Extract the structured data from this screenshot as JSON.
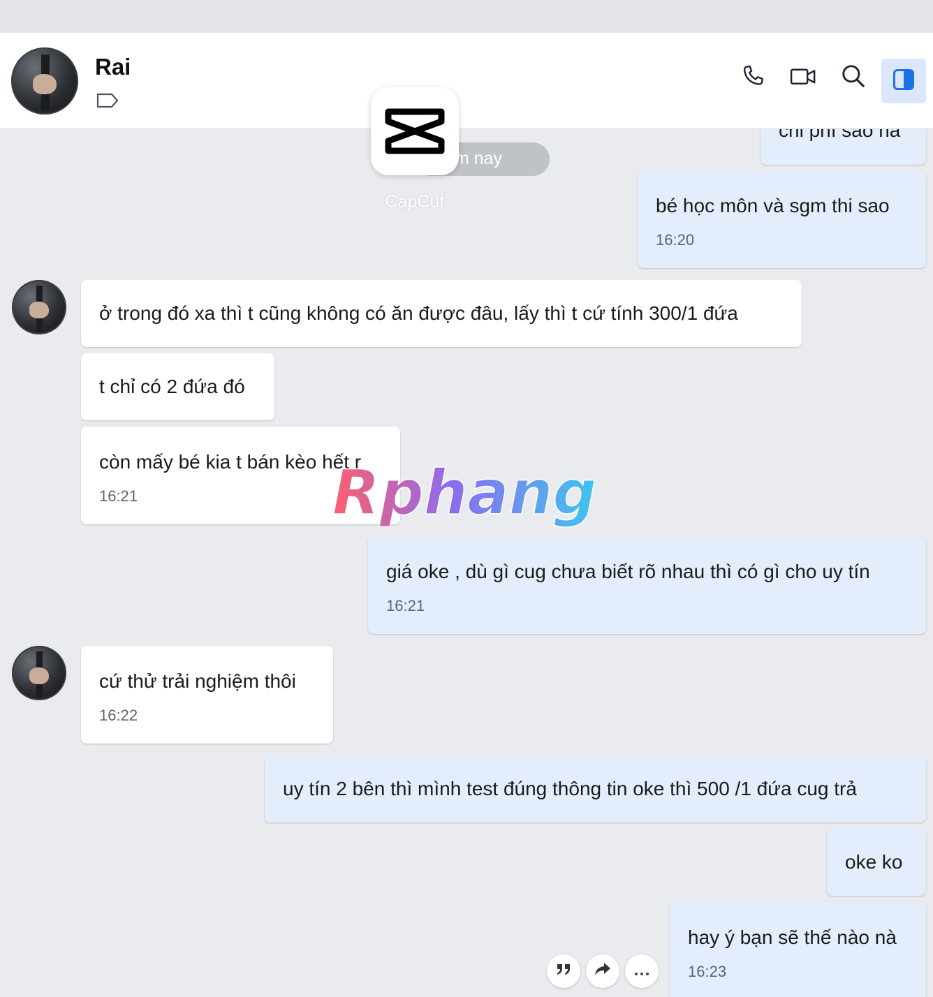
{
  "header": {
    "name": "Rai",
    "icons": [
      "tag-icon",
      "phone-icon",
      "video-icon",
      "search-icon",
      "sidebar-toggle-icon"
    ]
  },
  "overlay": {
    "date_pill_partial": "m nay",
    "app_label": "CapCut",
    "watermark_text": "Rphang"
  },
  "messages": [
    {
      "side": "out",
      "text": "chi phí sao nà",
      "time": ""
    },
    {
      "side": "out",
      "text": "bé học môn và sgm thi sao",
      "time": "16:20"
    },
    {
      "side": "in",
      "text": "ở trong đó xa thì t cũng không có ăn được đâu, lấy thì t cứ tính 300/1 đứa",
      "time": ""
    },
    {
      "side": "in",
      "text": "t chỉ có 2 đứa đó",
      "time": ""
    },
    {
      "side": "in",
      "text": "còn mấy bé kia t bán kèo hết r",
      "time": "16:21"
    },
    {
      "side": "out",
      "text": "giá oke , dù gì cug chưa biết rõ nhau thì có gì cho uy tín",
      "time": "16:21"
    },
    {
      "side": "in",
      "text": "cứ thử trải nghiệm thôi",
      "time": "16:22"
    },
    {
      "side": "out",
      "text": "uy tín 2 bên thì mình test đúng thông tin oke thì 500 /1 đứa cug trả",
      "time": ""
    },
    {
      "side": "out",
      "text": "oke ko",
      "time": ""
    },
    {
      "side": "out",
      "text": "hay ý bạn sẽ thế nào nà",
      "time": "16:23"
    }
  ],
  "message_actions": [
    "quote-icon",
    "forward-icon",
    "more-icon"
  ],
  "colors": {
    "incoming": "#ffffff",
    "outgoing": "#e4edfb",
    "background": "#e9ebef",
    "accent": "#1f6fe5"
  }
}
